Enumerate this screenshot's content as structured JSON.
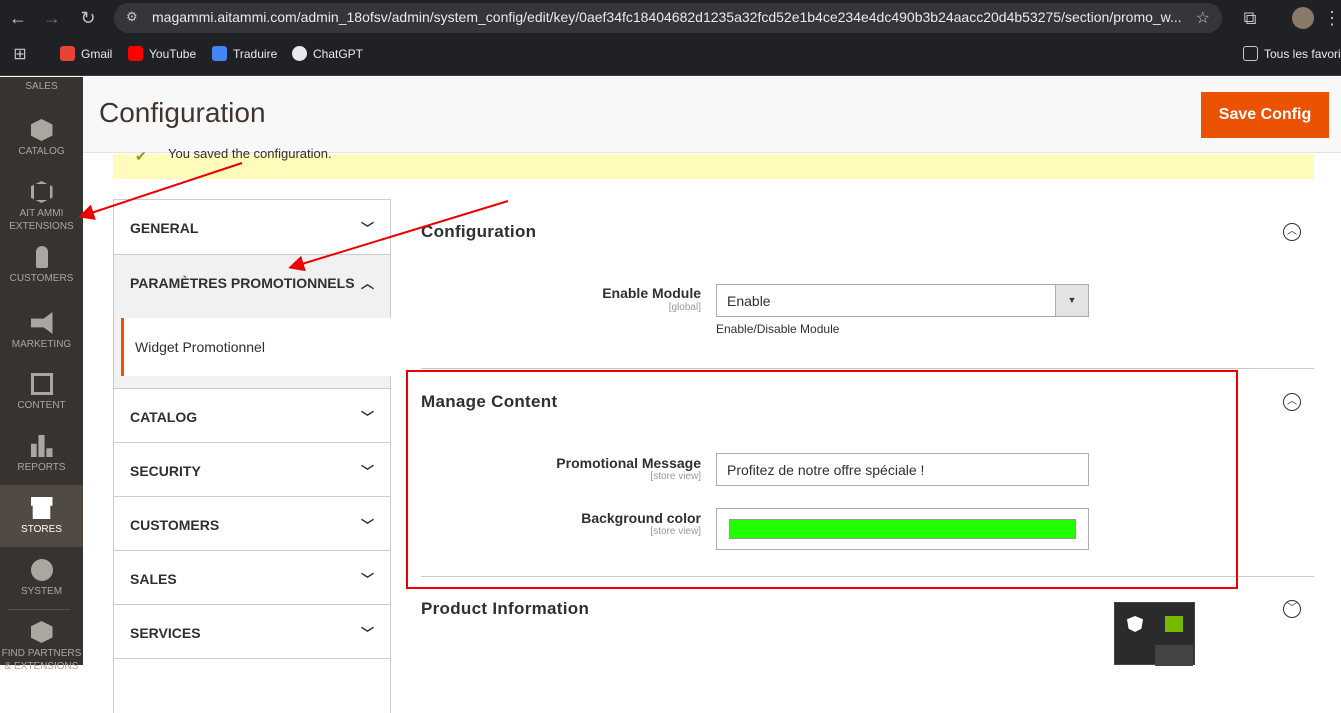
{
  "browser": {
    "url": "magammi.aitammi.com/admin_18ofsv/admin/system_config/edit/key/0aef34fc18404682d1235a32fcd52e1b4ce234e4dc490b3b24aacc20d4b53275/section/promo_w...",
    "bookmarks": [
      "Gmail",
      "YouTube",
      "Traduire",
      "ChatGPT"
    ],
    "all_bookmarks": "Tous les favoris"
  },
  "admin_nav": [
    {
      "label": "SALES",
      "icon": "dollar-icon"
    },
    {
      "label": "CATALOG",
      "icon": "cube-icon"
    },
    {
      "label": "AIT AMMI EXTENSIONS",
      "icon": "hexagon-icon"
    },
    {
      "label": "CUSTOMERS",
      "icon": "person-icon"
    },
    {
      "label": "MARKETING",
      "icon": "megaphone-icon"
    },
    {
      "label": "CONTENT",
      "icon": "layout-icon"
    },
    {
      "label": "REPORTS",
      "icon": "bar-chart-icon"
    },
    {
      "label": "STORES",
      "icon": "store-icon"
    },
    {
      "label": "SYSTEM",
      "icon": "gear-icon"
    },
    {
      "label": "FIND PARTNERS & EXTENSIONS",
      "icon": "cubes-icon"
    }
  ],
  "page": {
    "title": "Configuration",
    "save_button": "Save Config",
    "message": "You saved the configuration."
  },
  "tabs": {
    "general": "GENERAL",
    "promo": "PARAMÈTRES PROMOTIONNELS",
    "promo_sub": "Widget Promotionnel",
    "catalog": "CATALOG",
    "security": "SECURITY",
    "customers": "CUSTOMERS",
    "sales": "SALES",
    "services": "SERVICES"
  },
  "sections": {
    "configuration": {
      "title": "Configuration",
      "enable_label": "Enable Module",
      "enable_scope": "[global]",
      "enable_value": "Enable",
      "enable_note": "Enable/Disable Module"
    },
    "manage_content": {
      "title": "Manage Content",
      "message_label": "Promotional Message",
      "message_scope": "[store view]",
      "message_value": "Profitez de notre offre spéciale !",
      "bg_label": "Background color",
      "bg_scope": "[store view]",
      "bg_value_color": "#22ff00"
    },
    "product_info": {
      "title": "Product Information"
    }
  },
  "colors": {
    "accent": "#eb5202",
    "annotation": "#e00000"
  }
}
